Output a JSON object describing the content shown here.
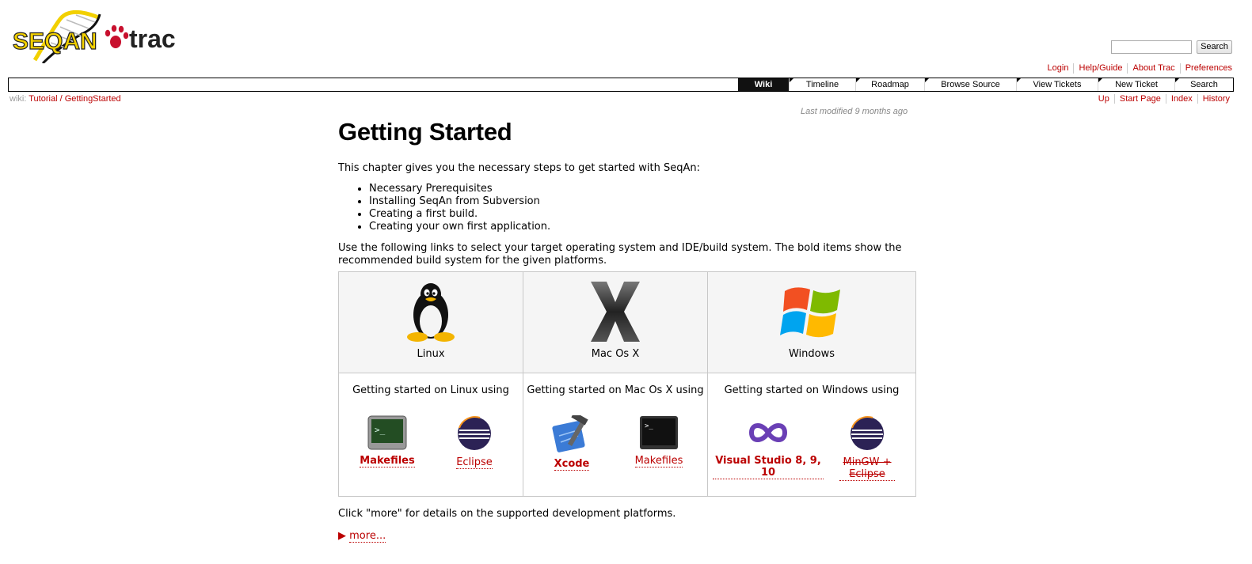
{
  "logo": {
    "seqan_text": "SEQAN",
    "trac_text": "trac"
  },
  "search": {
    "placeholder": "",
    "value": "",
    "button_label": "Search"
  },
  "metanav": [
    "Login",
    "Help/Guide",
    "About Trac",
    "Preferences"
  ],
  "mainnav": [
    {
      "label": "Wiki",
      "active": true
    },
    {
      "label": "Timeline"
    },
    {
      "label": "Roadmap"
    },
    {
      "label": "Browse Source"
    },
    {
      "label": "View Tickets"
    },
    {
      "label": "New Ticket"
    },
    {
      "label": "Search"
    }
  ],
  "breadcrumb": {
    "prefix": "wiki:",
    "parent": "Tutorial",
    "separator": "/",
    "current": "GettingStarted"
  },
  "ctxtnav": [
    "Up",
    "Start Page",
    "Index",
    "History"
  ],
  "last_modified": "Last modified 9 months ago",
  "page": {
    "title": "Getting Started",
    "intro": "This chapter gives you the necessary steps to get started with SeqAn:",
    "bullets": [
      "Necessary Prerequisites",
      "Installing SeqAn from Subversion",
      "Creating a first build.",
      "Creating your own first application."
    ],
    "links_text": "Use the following links to select your target operating system and IDE/build system. The bold items show the recommended build system for the given platforms.",
    "click_more": "Click \"more\" for details on the supported development platforms.",
    "more_label": "more..."
  },
  "platforms": [
    {
      "name": "Linux",
      "intro": "Getting started on Linux using",
      "tools": [
        {
          "label": "Makefiles",
          "bold": true,
          "icon": "terminal-icon"
        },
        {
          "label": "Eclipse",
          "icon": "eclipse-icon"
        }
      ]
    },
    {
      "name": "Mac Os X",
      "intro": "Getting started on Mac Os X using",
      "tools": [
        {
          "label": "Xcode",
          "bold": true,
          "icon": "xcode-icon"
        },
        {
          "label": "Makefiles",
          "icon": "terminal-icon"
        }
      ]
    },
    {
      "name": "Windows",
      "intro": "Getting started on Windows using",
      "tools": [
        {
          "label": "Visual Studio 8, 9, 10",
          "bold": true,
          "icon": "visual-studio-icon"
        },
        {
          "label": "MinGW + Eclipse",
          "strikethrough": true,
          "icon": "eclipse-icon"
        }
      ]
    }
  ],
  "colors": {
    "link": "#bb0000",
    "nav_active_bg": "#111111",
    "logo_yellow": "#f2d000",
    "logo_red": "#c8102e"
  }
}
